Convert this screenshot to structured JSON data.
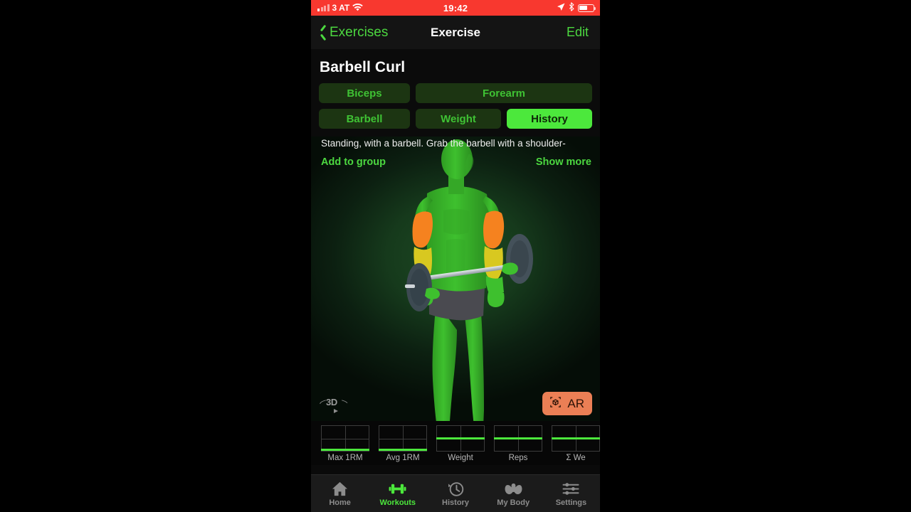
{
  "status_bar": {
    "carrier": "3 AT",
    "time": "19:42",
    "signal_icon": "signal-bars-icon",
    "wifi_icon": "wifi-icon",
    "location_icon": "location-arrow-icon",
    "bluetooth_icon": "bluetooth-icon",
    "battery_icon": "battery-icon",
    "battery_level": 60,
    "background_color": "#f8382f"
  },
  "nav_bar": {
    "back_label": "Exercises",
    "back_icon": "chevron-left-icon",
    "title": "Exercise",
    "edit_label": "Edit",
    "accent_color": "#4cd840"
  },
  "exercise": {
    "title": "Barbell Curl",
    "description": "Standing, with a barbell. Grab the barbell with a shoulder-",
    "add_to_group_label": "Add to group",
    "show_more_label": "Show more"
  },
  "tags": {
    "row1": [
      {
        "label": "Biceps",
        "selected": false
      },
      {
        "label": "Forearm",
        "selected": false
      }
    ],
    "row2": [
      {
        "label": "Barbell",
        "selected": false
      },
      {
        "label": "Weight",
        "selected": false
      },
      {
        "label": "History",
        "selected": true
      }
    ],
    "selected_color": "#4ce83c",
    "idle_color": "#1c3512"
  },
  "viewer": {
    "rotate_badge_label": "3D",
    "rotate_badge_icon": "rotate-3d-icon",
    "ar_button_label": "AR",
    "ar_button_icon": "ar-cube-icon",
    "ar_button_color": "#eb7f55",
    "model_body_color": "#3ec02e",
    "model_highlight_color": "#f5821f",
    "model_secondary_highlight_color": "#d8c820",
    "model_shorts_color": "#4a4a50",
    "barbell_plate_color": "#3d4a52",
    "barbell_bar_color": "#c9ced2"
  },
  "chart_data": [
    {
      "type": "line",
      "title": "Max 1RM",
      "values": [
        0,
        0
      ],
      "ylim": [
        0,
        1
      ],
      "line_level": 0.0,
      "grid": true
    },
    {
      "type": "line",
      "title": "Avg 1RM",
      "values": [
        0,
        0
      ],
      "ylim": [
        0,
        1
      ],
      "line_level": 0.0,
      "grid": true
    },
    {
      "type": "line",
      "title": "Weight",
      "values": [
        0.5,
        0.5
      ],
      "ylim": [
        0,
        1
      ],
      "line_level": 0.5,
      "grid": true
    },
    {
      "type": "line",
      "title": "Reps",
      "values": [
        0.5,
        0.5
      ],
      "ylim": [
        0,
        1
      ],
      "line_level": 0.5,
      "grid": true
    },
    {
      "type": "line",
      "title": "Σ We",
      "values": [
        0.5,
        0.5
      ],
      "ylim": [
        0,
        1
      ],
      "line_level": 0.5,
      "grid": true
    }
  ],
  "tab_bar": {
    "items": [
      {
        "label": "Home",
        "icon": "home-icon",
        "active": false
      },
      {
        "label": "Workouts",
        "icon": "dumbbell-icon",
        "active": true
      },
      {
        "label": "History",
        "icon": "clock-history-icon",
        "active": false
      },
      {
        "label": "My Body",
        "icon": "muscle-arms-icon",
        "active": false
      },
      {
        "label": "Settings",
        "icon": "sliders-icon",
        "active": false
      }
    ],
    "active_color": "#4ce83c",
    "idle_color": "#8c8c8c"
  }
}
